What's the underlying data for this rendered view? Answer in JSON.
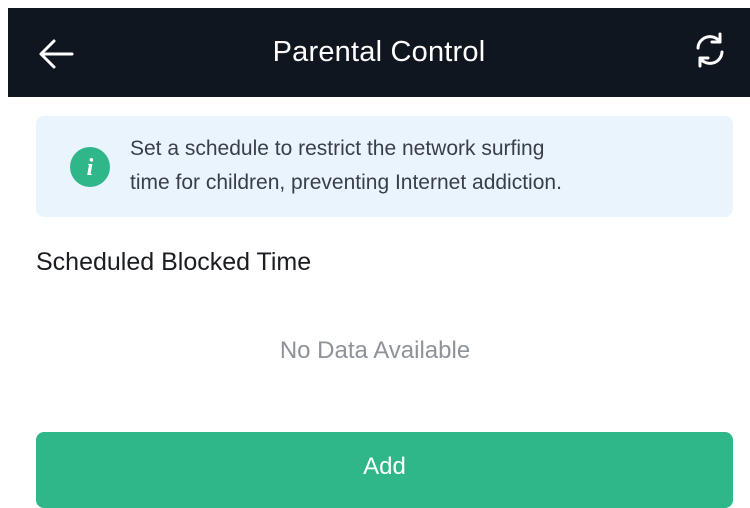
{
  "header": {
    "title": "Parental Control",
    "back_icon": "arrow-left-icon",
    "refresh_icon": "refresh-icon",
    "background_color": "#10161f"
  },
  "info": {
    "icon": "info-icon",
    "line1": "Set a schedule to restrict the network surfing",
    "line2": "time for children, preventing Internet addiction.",
    "icon_color": "#2fb689",
    "background_color": "#e9f4fd"
  },
  "section": {
    "title": "Scheduled Blocked Time",
    "empty_text": "No Data Available"
  },
  "actions": {
    "add_label": "Add",
    "add_color": "#2fb689"
  }
}
